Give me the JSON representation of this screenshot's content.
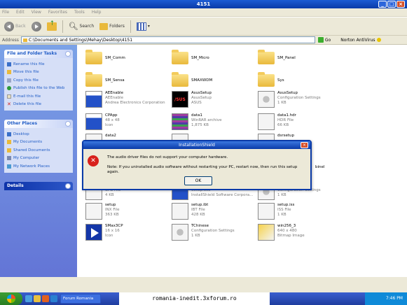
{
  "window": {
    "title": "4151"
  },
  "menu": [
    "File",
    "Edit",
    "View",
    "Favorites",
    "Tools",
    "Help"
  ],
  "toolbar": {
    "back": "Back",
    "search": "Search",
    "folders": "Folders"
  },
  "address": {
    "label": "Address",
    "path": "C:\\Documents and Settings\\Mehay\\Desktop\\4151",
    "go": "Go",
    "norton": "Norton AntiVirus"
  },
  "sidebar": {
    "tasks_title": "File and Folder Tasks",
    "tasks": [
      "Rename this file",
      "Move this file",
      "Copy this file",
      "Publish this file to the Web",
      "E-mail this file",
      "Delete this file"
    ],
    "places_title": "Other Places",
    "places": [
      "Desktop",
      "My Documents",
      "Shared Documents",
      "My Computer",
      "My Network Places"
    ],
    "details_title": "Details"
  },
  "files": [
    {
      "name": "SM_Comm",
      "icon": "folder-icon"
    },
    {
      "name": "SM_Micro",
      "icon": "folder-icon"
    },
    {
      "name": "SM_Panel",
      "icon": "folder-icon"
    },
    {
      "name": "SM_Sensa",
      "icon": "folder-icon"
    },
    {
      "name": "SMAXWDM",
      "icon": "folder-icon"
    },
    {
      "name": "Sys",
      "icon": "folder-icon"
    },
    {
      "name": "AEEnable",
      "l2": "AEEnable",
      "l3": "Andrea Electronics Corporation",
      "icon": "app-icon"
    },
    {
      "name": "AsusSetup",
      "l2": "AsusSetup",
      "l3": "ASUS",
      "icon": "asus-icon"
    },
    {
      "name": "AsusSetup",
      "l2": "Configuration Settings",
      "l3": "1 KB",
      "icon": "config-icon"
    },
    {
      "name": "CPApp",
      "l2": "48 x 48",
      "l3": "Icon",
      "icon": "image-icon"
    },
    {
      "name": "data1",
      "l2": "WinRAR archive",
      "l3": "1,875 KB",
      "icon": "winrar-icon"
    },
    {
      "name": "data1.hdr",
      "l2": "HDR File",
      "l3": "66 KB",
      "icon": "file-icon"
    },
    {
      "name": "data2",
      "l2": "",
      "l3": "",
      "icon": "file-icon"
    },
    {
      "name": "",
      "l2": "",
      "l3": "",
      "icon": "file-icon"
    },
    {
      "name": "dsrsetup",
      "l2": "",
      "l3": "",
      "icon": "file-icon"
    },
    {
      "name": "",
      "l2": "",
      "l3": "Microsoft Corporation",
      "icon": "file-icon"
    },
    {
      "name": "",
      "l2": "",
      "l3": "2 KB",
      "icon": "file-icon"
    },
    {
      "name": "",
      "l2": "",
      "l3": "6 KB",
      "icon": "file-icon"
    },
    {
      "name": "platform.cfg",
      "l2": "CFG File",
      "l3": "4 KB",
      "icon": "file-icon"
    },
    {
      "name": "setup",
      "l2": "Setup.exe",
      "l3": "InstallShield Software Corpora...",
      "icon": "setup-icon"
    },
    {
      "name": "setup",
      "l2": "Configuration Settings",
      "l3": "1 KB",
      "icon": "config-icon"
    },
    {
      "name": "setup",
      "l2": "INX File",
      "l3": "363 KB",
      "icon": "file-icon"
    },
    {
      "name": "setup.ibt",
      "l2": "IBT File",
      "l3": "428 KB",
      "icon": "file-icon"
    },
    {
      "name": "setup.iss",
      "l2": "ISS File",
      "l3": "1 KB",
      "icon": "file-icon"
    },
    {
      "name": "SMax3CP",
      "l2": "16 x 16",
      "l3": "Icon",
      "icon": "play-icon"
    },
    {
      "name": "TChinese",
      "l2": "Configuration Settings",
      "l3": "1 KB",
      "icon": "config-icon"
    },
    {
      "name": "win256_3",
      "l2": "640 x 480",
      "l3": "Bitmap Image",
      "icon": "bitmap-icon"
    }
  ],
  "dialog": {
    "title": "InstallationShield",
    "message": "The audio driver files do not support your computer hardware.",
    "note": "Note: If you uninstalled audio software without restarting your PC, restart now, then run this setup again.",
    "ok": "OK"
  },
  "taskbar": {
    "task": "Forum Romania",
    "time": "7:46 PM"
  },
  "watermark": "romania-inedit.3xforum.ro",
  "sidebar_right_partial": "binel"
}
